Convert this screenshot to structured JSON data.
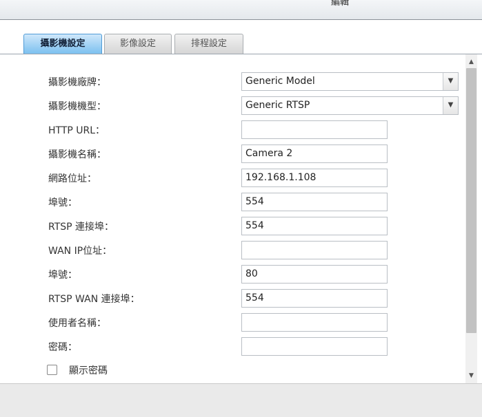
{
  "window": {
    "title": "編輯"
  },
  "tabs": [
    {
      "label": "攝影機設定",
      "active": true
    },
    {
      "label": "影像設定",
      "active": false
    },
    {
      "label": "排程設定",
      "active": false
    }
  ],
  "form": {
    "brand": {
      "label": "攝影機廠牌：",
      "value": "Generic Model"
    },
    "model": {
      "label": "攝影機機型：",
      "value": "Generic RTSP"
    },
    "http_url": {
      "label": "HTTP URL：",
      "value": ""
    },
    "camera_name": {
      "label": "攝影機名稱：",
      "value": "Camera 2"
    },
    "ip_address": {
      "label": "網路位址：",
      "value": "192.168.1.108"
    },
    "port": {
      "label": "埠號：",
      "value": "554"
    },
    "rtsp_port": {
      "label": "RTSP 連接埠：",
      "value": "554"
    },
    "wan_ip": {
      "label": "WAN IP位址：",
      "value": ""
    },
    "wan_port": {
      "label": "埠號：",
      "value": "80"
    },
    "rtsp_wan_port": {
      "label": "RTSP WAN 連接埠：",
      "value": "554"
    },
    "username": {
      "label": "使用者名稱：",
      "value": ""
    },
    "password": {
      "label": "密碼：",
      "value": ""
    },
    "show_password": {
      "label": "顯示密碼",
      "checked": false
    }
  },
  "icons": {
    "dropdown": "chevron-down-icon",
    "scroll_up": "triangle-up-icon",
    "scroll_down": "triangle-down-icon"
  }
}
